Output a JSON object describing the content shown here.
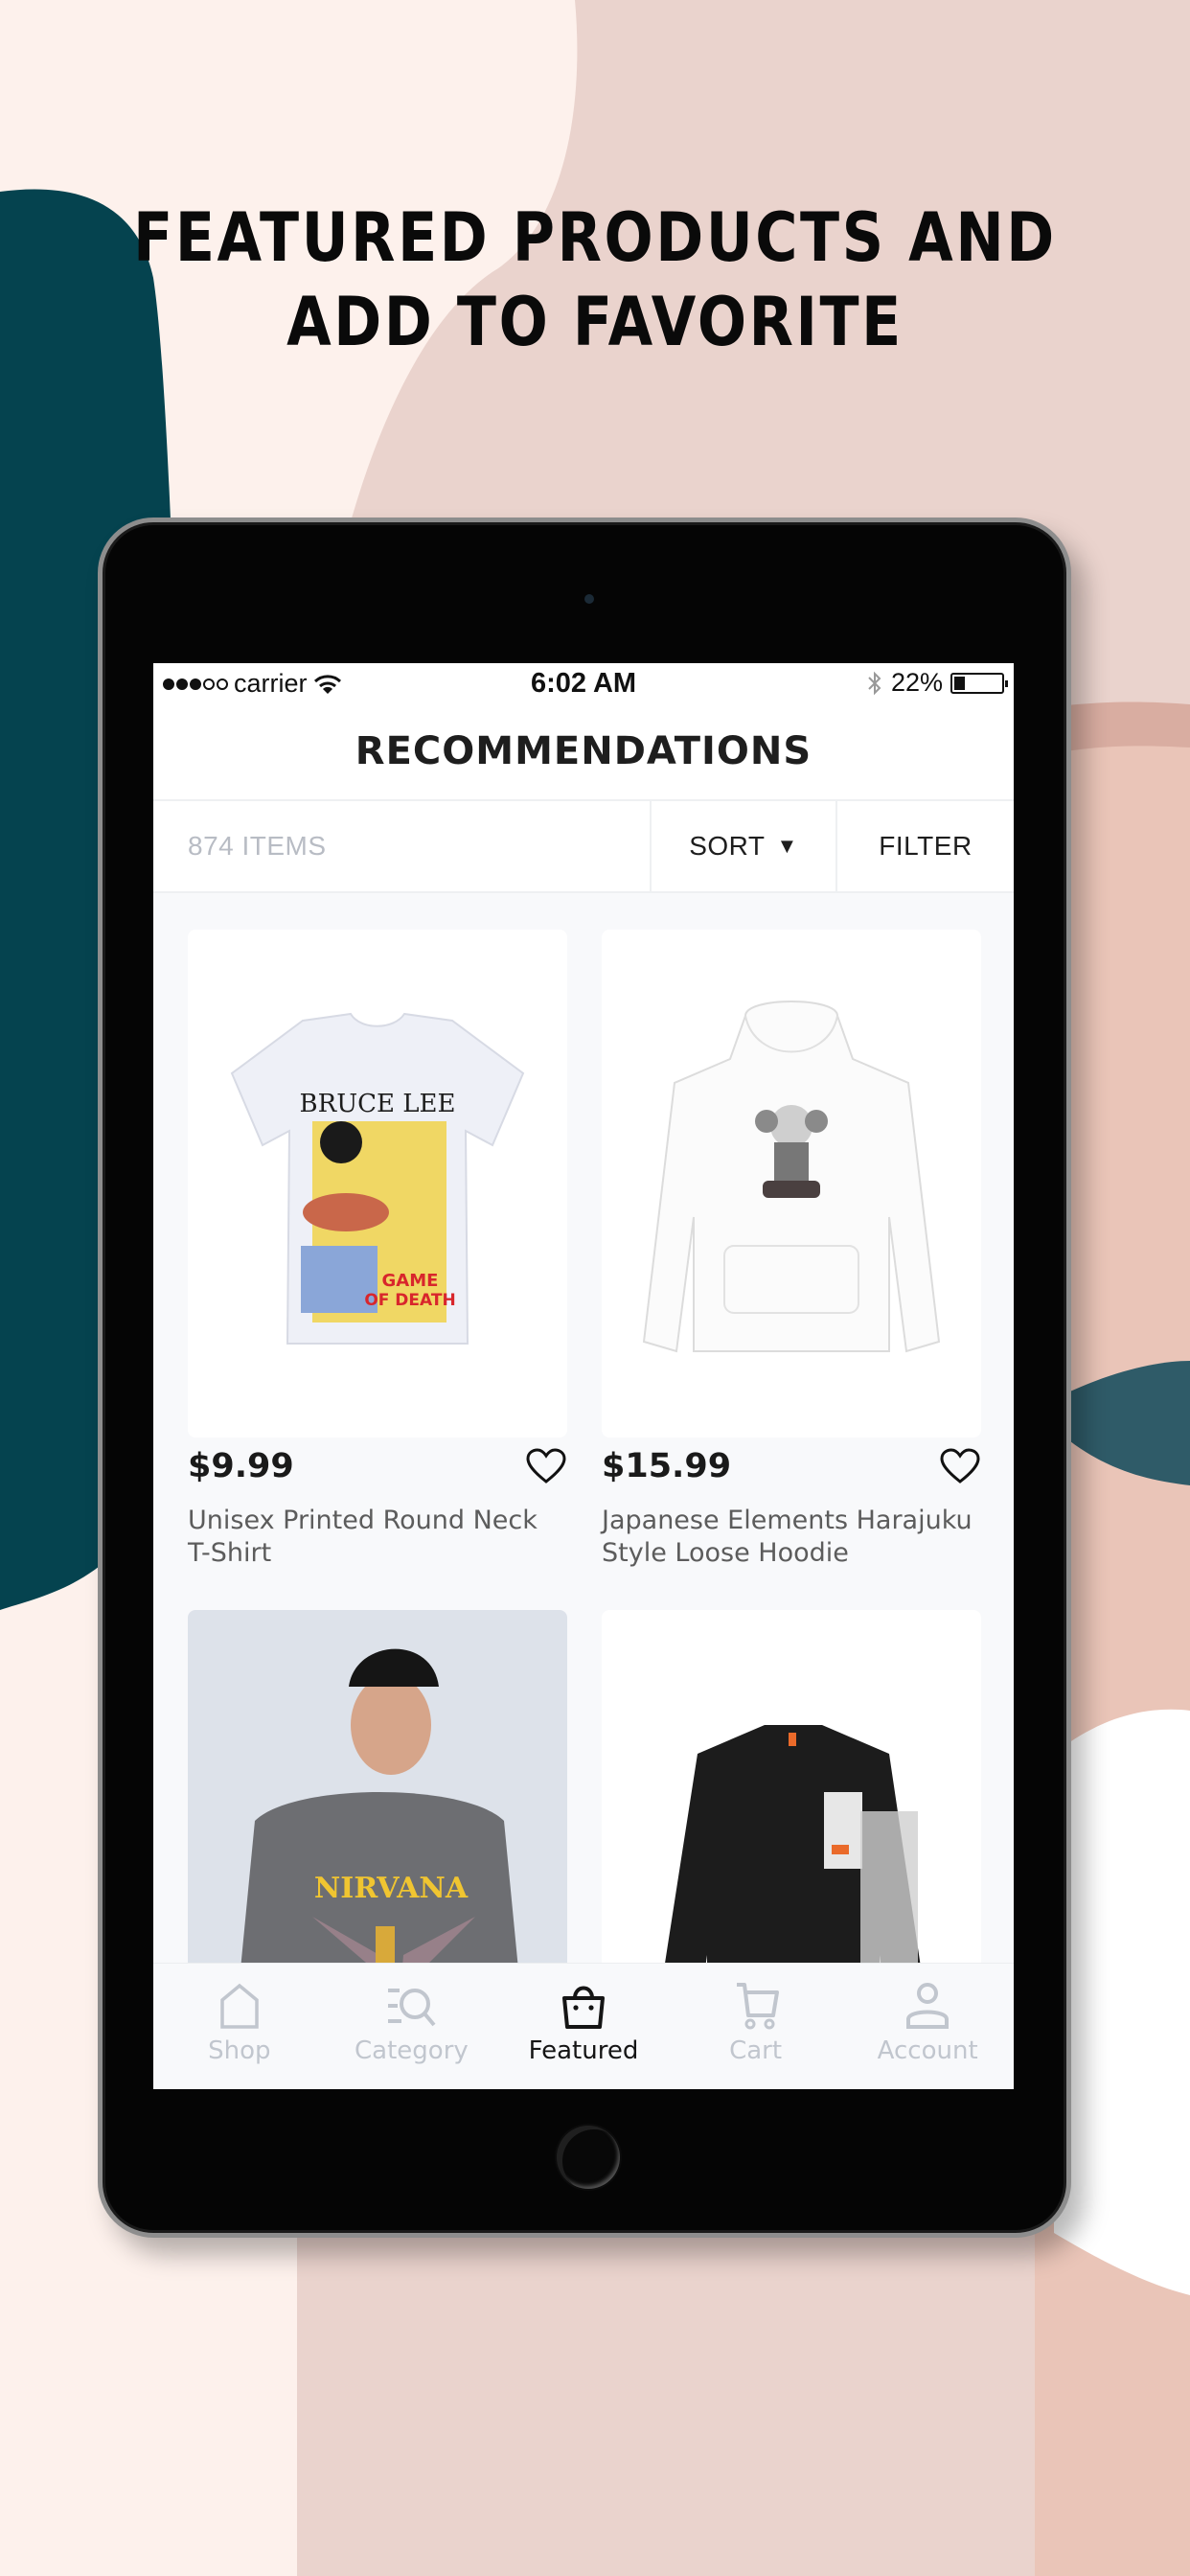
{
  "headline": {
    "line1": "FEATURED PRODUCTS AND",
    "line2": "ADD TO FAVORITE"
  },
  "colors": {
    "teal": "#05434f",
    "teal_light": "#2f5b68",
    "pink": "#ead3cd",
    "peach": "#eac5b8",
    "cream": "#fdf1ec",
    "active_tab": "#151515",
    "inactive_tab": "#c1c6ce"
  },
  "status_bar": {
    "signal_strength": "3 of 5",
    "carrier": "carrier",
    "wifi_icon": "wifi-icon",
    "time": "6:02 AM",
    "bluetooth_icon": "bluetooth-icon",
    "battery_percent": "22%",
    "battery_level": 0.22
  },
  "page": {
    "title": "RECOMMENDATIONS"
  },
  "toolbar": {
    "item_count": "874 ITEMS",
    "sort_label": "SORT",
    "sort_caret": "▼",
    "filter_label": "FILTER"
  },
  "products": [
    {
      "price": "$9.99",
      "name": "Unisex Printed Round Neck T-Shirt",
      "image": "bruce-lee-tshirt",
      "favorited": false
    },
    {
      "price": "$15.99",
      "name": "Japanese Elements Harajuku Style Loose Hoodie",
      "image": "kaws-hoodie",
      "favorited": false
    },
    {
      "price": "",
      "name": "",
      "image": "nirvana-sweatshirt",
      "favorited": false
    },
    {
      "price": "",
      "name": "",
      "image": "plaid-denim-jacket",
      "favorited": false
    }
  ],
  "product_art": {
    "tshirt_title": "BRUCE LEE",
    "tshirt_sub1": "GAME",
    "tshirt_sub2": "OF DEATH",
    "sweatshirt_text": "NIRVANA"
  },
  "tab_bar": {
    "items": [
      {
        "label": "Shop",
        "icon": "home-icon",
        "active": false
      },
      {
        "label": "Category",
        "icon": "category-search-icon",
        "active": false
      },
      {
        "label": "Featured",
        "icon": "shopping-bag-icon",
        "active": true
      },
      {
        "label": "Cart",
        "icon": "cart-icon",
        "active": false
      },
      {
        "label": "Account",
        "icon": "user-icon",
        "active": false
      }
    ]
  }
}
